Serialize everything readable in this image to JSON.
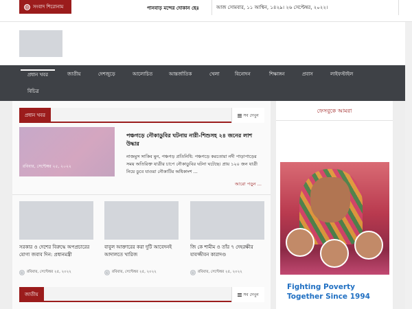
{
  "topbar": {
    "headline_badge": "সংবাদ শিরোনাম",
    "ticker": "পানবাড় মন্দের দোকান ছেঃ",
    "date": "আজ সোমবার, ১১ আশ্বিন, ১৪২৯। ২৬ সেপ্টেম্বর, ২০২২।"
  },
  "nav": {
    "items": [
      "প্রধান খবর",
      "জাতীয়",
      "দেশজুড়ে",
      "আলোচিত",
      "আন্তর্জাতিক",
      "খেলা",
      "বিনোদন",
      "শিক্ষাঙ্গন",
      "প্রবাস",
      "লাইফস্টাইল",
      "বিচিত্র"
    ]
  },
  "main": {
    "section_title": "প্রধান খবর",
    "see_all": "সব দেখুন",
    "lead": {
      "image_caption": "রবিবার, সেপ্টেম্বর ২৫, ২০২২",
      "title": "পঞ্চগড়ে নৌকাডুবির ঘটনায় নারী-শিশুসহ ২৪ জনের লাশ উদ্ধার",
      "body": "নাজমুস সাকিব মুন, পঞ্চগড় প্রতিনিধি: পঞ্চগড়ে করতোয়া নদী পাড়াপাড়ের সময় অতিরিক্ত যাত্রীর চাপে নৌকাডুবির ঘটনা ঘটেছে। প্রায় ১২০ জন যাত্রী নিয়ে ডুবে যাওয়া নৌকাটির অধিকাংশ ...",
      "read_more": "আরো পড়ুন ..."
    },
    "cards": [
      {
        "title": "সরকার ও দেশের বিরুদ্ধে অপপ্রচারের যোগ্য জবাব দিন: প্রধানমন্ত্রী",
        "meta": "রবিবার, সেপ্টেম্বর ২৫, ২০২২"
      },
      {
        "title": "বাবুল আক্তারের করা দুটি আবেদনই আদালতে খারিজ",
        "meta": "রবিবার, সেপ্টেম্বর ২৫, ২০২২"
      },
      {
        "title": "জি কে শামীম ও তাঁর ৭ দেহরক্ষীর যাবজ্জীবন কারাদণ্ড",
        "meta": "রবিবার, সেপ্টেম্বর ২৫, ২০২২"
      }
    ],
    "section2_title": "জাতীয়",
    "section2_see_all": "সব দেখুন"
  },
  "sidebar": {
    "facebook_title": "ফেসবুকে আমরা",
    "ad_line1": "Fighting Poverty",
    "ad_line2": "Together Since 1994"
  },
  "colors": {
    "accent": "#9b1c1c",
    "nav_bg": "#3e4146",
    "ad_text": "#1f6fc2"
  }
}
